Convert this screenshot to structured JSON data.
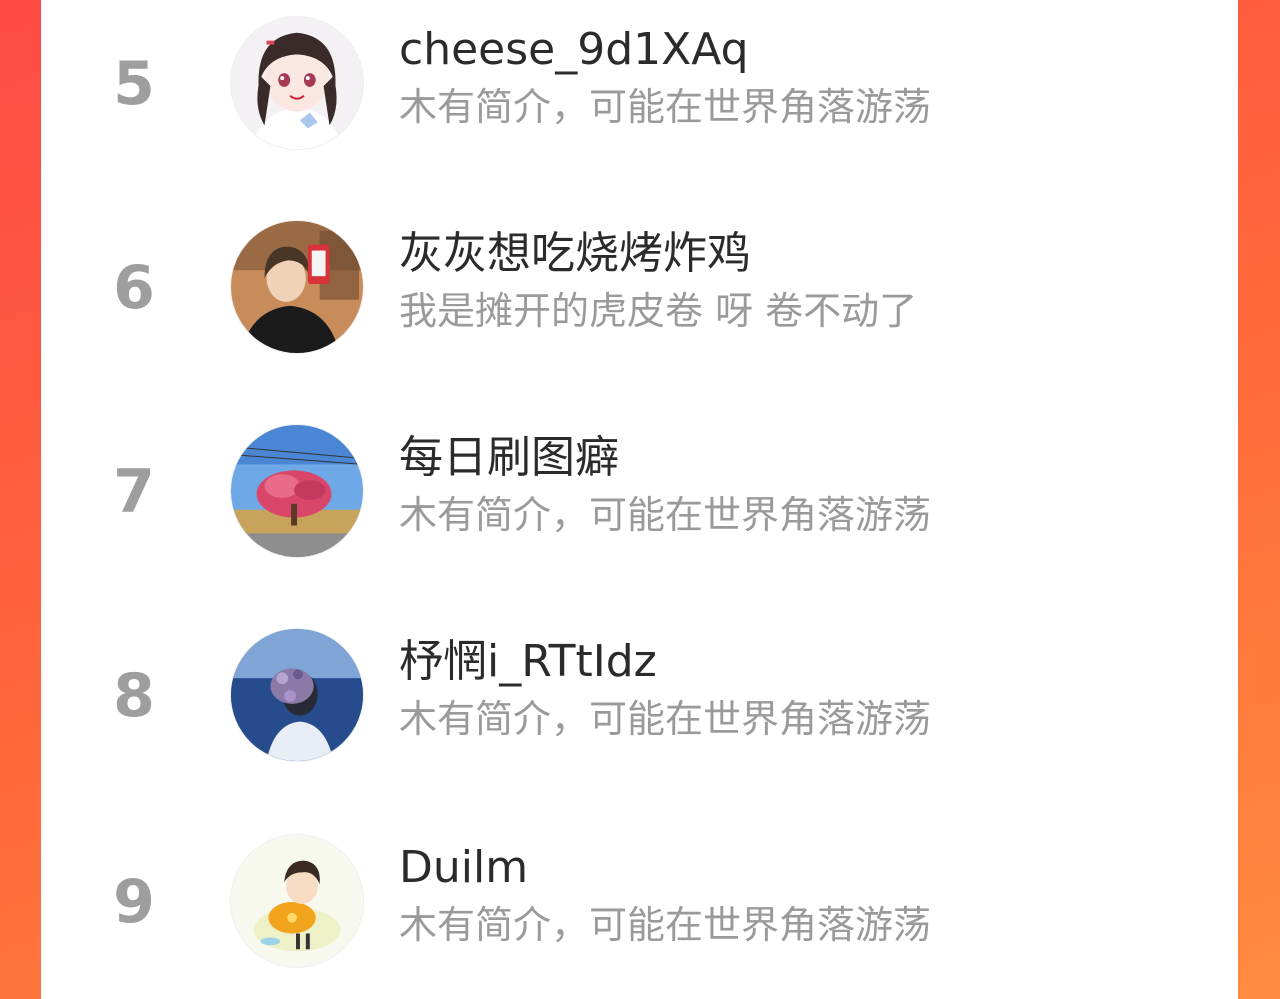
{
  "list": {
    "items": [
      {
        "rank": "5",
        "name": "cheese_9d1XAq",
        "bio": "木有简介，可能在世界角落游荡",
        "avatar_icon": "anime-girl-avatar"
      },
      {
        "rank": "6",
        "name": "灰灰想吃烧烤炸鸡",
        "bio": "我是摊开的虎皮卷 呀 卷不动了",
        "avatar_icon": "selfie-photo-avatar"
      },
      {
        "rank": "7",
        "name": "每日刷图癖",
        "bio": "木有简介，可能在世界角落游荡",
        "avatar_icon": "blossom-tree-avatar"
      },
      {
        "rank": "8",
        "name": "杼惘i_RTtIdz",
        "bio": "木有简介，可能在世界角落游荡",
        "avatar_icon": "girl-with-flowers-avatar"
      },
      {
        "rank": "9",
        "name": "Duilm",
        "bio": "木有简介，可能在世界角落游荡",
        "avatar_icon": "cartoon-boy-avatar"
      }
    ]
  }
}
